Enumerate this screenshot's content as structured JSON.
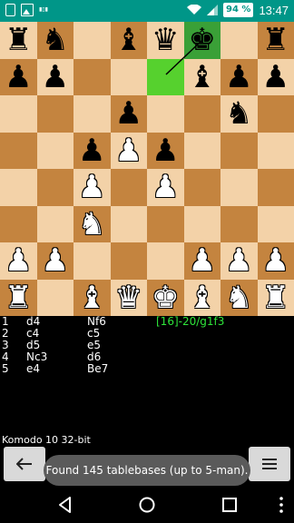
{
  "status_bar": {
    "battery": "94 %",
    "time": "13:47",
    "left_icons": [
      "usb-icon",
      "gallery-icon",
      "vibrate-icon"
    ],
    "right_icons": [
      "wifi-icon",
      "signal-icon",
      "battery-icon"
    ]
  },
  "board": {
    "squares": [
      [
        "bR",
        "bN",
        "",
        "bB",
        "bQ",
        "bK",
        "",
        "bR"
      ],
      [
        "bP",
        "bP",
        "",
        "",
        "",
        "bB",
        "bP",
        "bP"
      ],
      [
        "",
        "",
        "",
        "bP",
        "",
        "",
        "bN",
        ""
      ],
      [
        "",
        "",
        "bP",
        "wP",
        "bP",
        "",
        "",
        ""
      ],
      [
        "",
        "",
        "wP",
        "",
        "wP",
        "",
        "",
        ""
      ],
      [
        "",
        "",
        "wN",
        "",
        "",
        "",
        "",
        ""
      ],
      [
        "wP",
        "wP",
        "",
        "",
        "",
        "wP",
        "wP",
        "wP"
      ],
      [
        "wR",
        "",
        "wB",
        "wQ",
        "wK",
        "wB",
        "wN",
        "wR"
      ]
    ],
    "highlight_from": [
      0,
      5
    ],
    "highlight_to": [
      1,
      4
    ]
  },
  "moves": [
    {
      "num": "1",
      "white": "d4",
      "black": "Nf6"
    },
    {
      "num": "2",
      "white": "c4",
      "black": "c5"
    },
    {
      "num": "3",
      "white": "d5",
      "black": "e5"
    },
    {
      "num": "4",
      "white": "Nc3",
      "black": "d6"
    },
    {
      "num": "5",
      "white": "e4",
      "black": "Be7"
    }
  ],
  "analysis": "[16]-20/g1f3",
  "engine": "Komodo 10 32-bit",
  "toolbar": {
    "back_icon": "arrow-left-icon",
    "menu_icon": "menu-icon",
    "toast": "Found 145 tablebases (up to 5-man)."
  },
  "colors": {
    "status_bar": "#009688",
    "light_square": "#f3d2a8",
    "dark_square": "#c4843f",
    "highlight_from": "#3aa037",
    "highlight_to": "#56d12e",
    "analysis_text": "#2ee53a"
  }
}
